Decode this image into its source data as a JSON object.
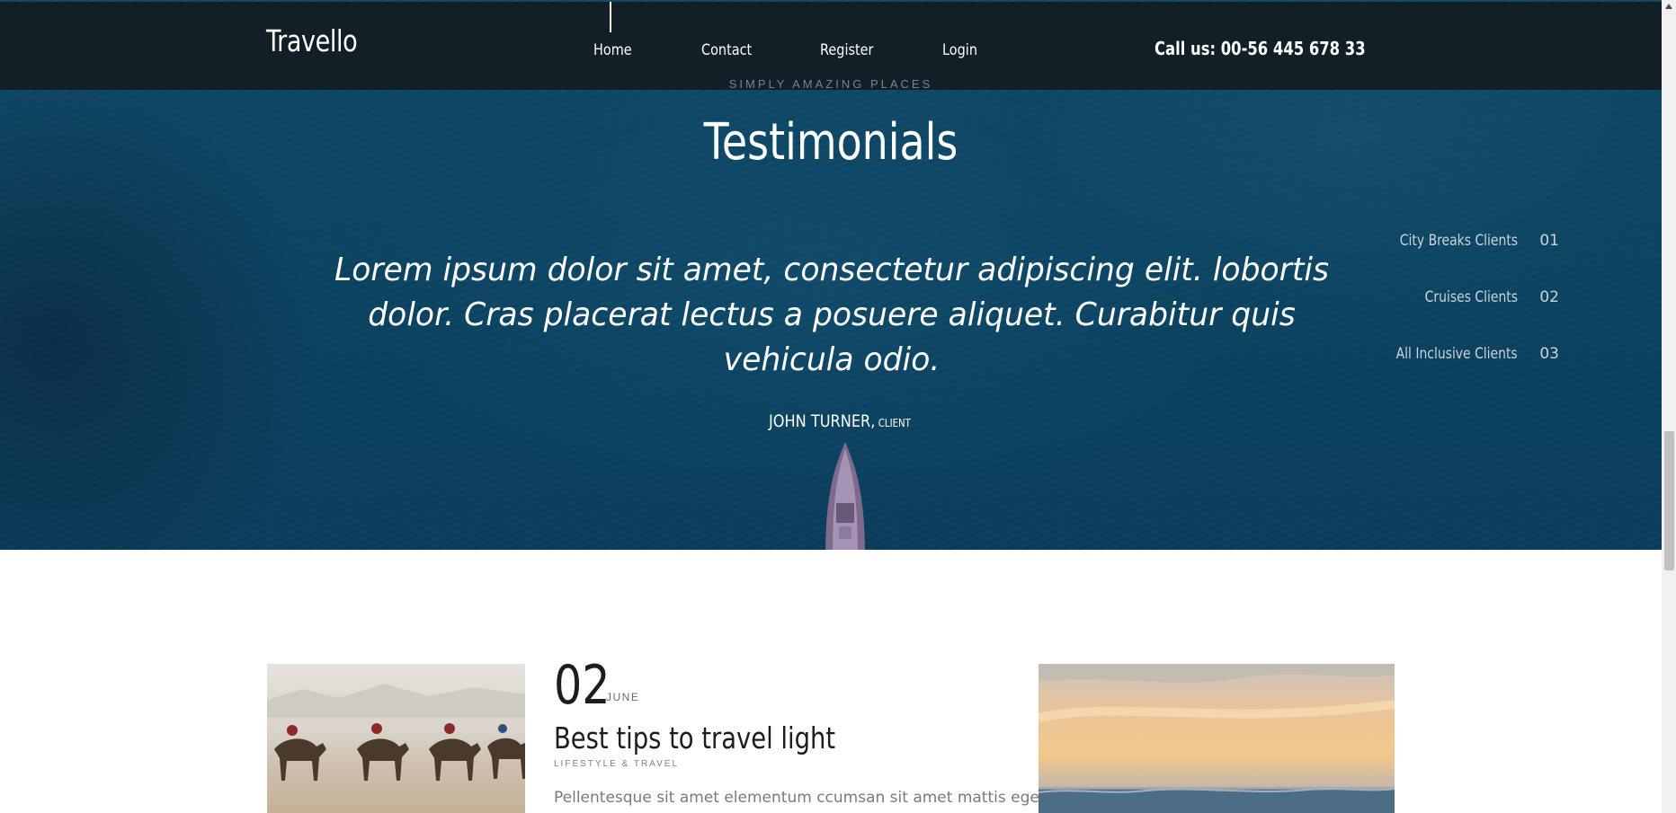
{
  "header": {
    "logo": "Travello",
    "nav": [
      "Home",
      "Contact",
      "Register",
      "Login"
    ],
    "call": "Call us: 00-56 445 678 33"
  },
  "testimonials": {
    "kicker": "SIMPLY AMAZING PLACES",
    "title": "Testimonials",
    "quote": "Lorem ipsum dolor sit amet, consectetur adipiscing elit. lobortis dolor. Cras placerat lectus a posuere aliquet. Curabitur quis vehicula odio.",
    "author": "JOHN TURNER,",
    "role": "CLIENT",
    "tabs": [
      {
        "label": "City Breaks Clients",
        "num": "01"
      },
      {
        "label": "Cruises Clients",
        "num": "02"
      },
      {
        "label": "All Inclusive Clients",
        "num": "03"
      }
    ]
  },
  "blog": {
    "post": {
      "day": "02",
      "month": "JUNE",
      "title": "Best tips to travel light",
      "category": "LIFESTYLE & TRAVEL",
      "excerpt": "Pellentesque sit amet elementum ccumsan sit amet mattis eget,"
    }
  },
  "colors": {
    "topbar": "#121c22",
    "hero": "#0b4463",
    "accent_text": "#6f8793"
  }
}
